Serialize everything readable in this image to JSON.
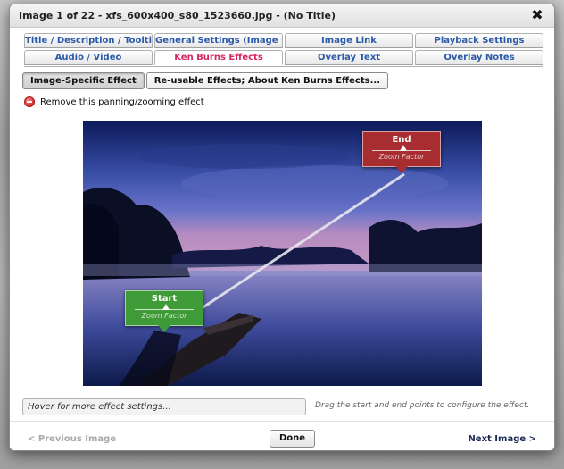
{
  "dialog": {
    "title": "Image 1 of 22 - xfs_600x400_s80_1523660.jpg - (No Title)",
    "close_symbol": "✖"
  },
  "tabs": {
    "row1": [
      {
        "label": "Title / Description / Tooltip"
      },
      {
        "label": "General Settings (Image URLs)"
      },
      {
        "label": "Image Link"
      },
      {
        "label": "Playback Settings"
      }
    ],
    "row2": [
      {
        "label": "Audio / Video"
      },
      {
        "label": "Ken Burns Effects",
        "active": true
      },
      {
        "label": "Overlay Text"
      },
      {
        "label": "Overlay Notes"
      }
    ]
  },
  "subtabs": [
    {
      "label": "Image-Specific Effect",
      "active": true
    },
    {
      "label": "Re-usable Effects; About Ken Burns Effects..."
    }
  ],
  "remove_effect": {
    "label": "Remove this panning/zooming effect",
    "icon": "remove-circle-icon"
  },
  "markers": {
    "end": {
      "title": "End",
      "subtitle": "Zoom Factor",
      "color": "#a72d31"
    },
    "start": {
      "title": "Start",
      "subtitle": "Zoom Factor",
      "color": "#3e9b37"
    }
  },
  "effect_settings": {
    "hover_text": "Hover for more effect settings...",
    "hint": "Drag the start and end points to configure the effect."
  },
  "footer": {
    "prev_label": "< Previous Image",
    "done_label": "Done",
    "next_label": "Next Image >"
  },
  "colors": {
    "tab_text": "#2b5aa8",
    "active_tab_text": "#d4275f"
  }
}
